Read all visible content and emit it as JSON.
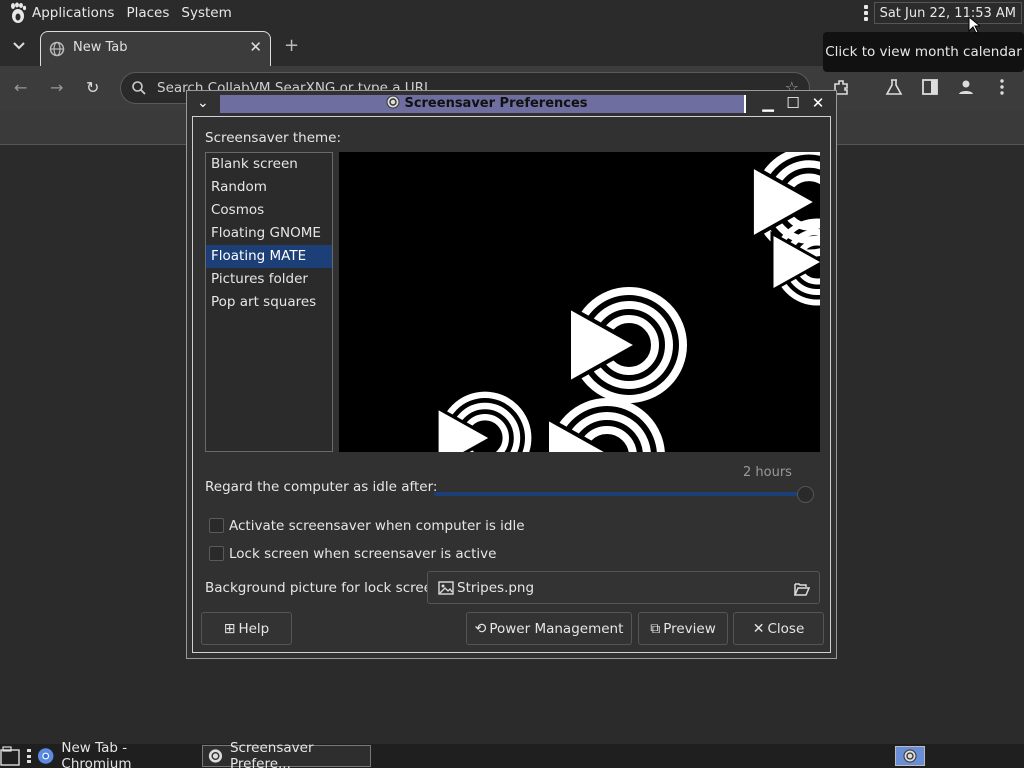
{
  "top_panel": {
    "menus": [
      "Applications",
      "Places",
      "System"
    ],
    "clock": "Sat Jun 22, 11:53 AM",
    "tooltip": "Click to view month calendar"
  },
  "browser": {
    "tab_title": "New Tab",
    "omnibox_text": "Search CollabVM SearXNG or type a URL"
  },
  "dialog": {
    "title": "Screensaver Preferences",
    "theme_label": "Screensaver theme:",
    "themes": [
      "Blank screen",
      "Random",
      "Cosmos",
      "Floating GNOME",
      "Floating MATE",
      "Pictures folder",
      "Pop art squares"
    ],
    "selected_theme": "Floating MATE",
    "idle_label": "Regard the computer as idle after:",
    "idle_value": "2 hours",
    "idle_fraction": 1.0,
    "activate_label": "Activate screensaver when computer is idle",
    "activate_checked": false,
    "lock_label": "Lock screen when screensaver is active",
    "lock_checked": false,
    "bg_label": "Background picture for lock screen:",
    "bg_file": "Stripes.png",
    "buttons": {
      "help": "Help",
      "power": "Power Management",
      "preview": "Preview",
      "close": "Close"
    }
  },
  "taskbar": {
    "items": [
      "New Tab - Chromium",
      "Screensaver Prefere..."
    ]
  },
  "colors": {
    "accent": "#1c3f78",
    "titlebar_grip": "#6e6ea0"
  }
}
